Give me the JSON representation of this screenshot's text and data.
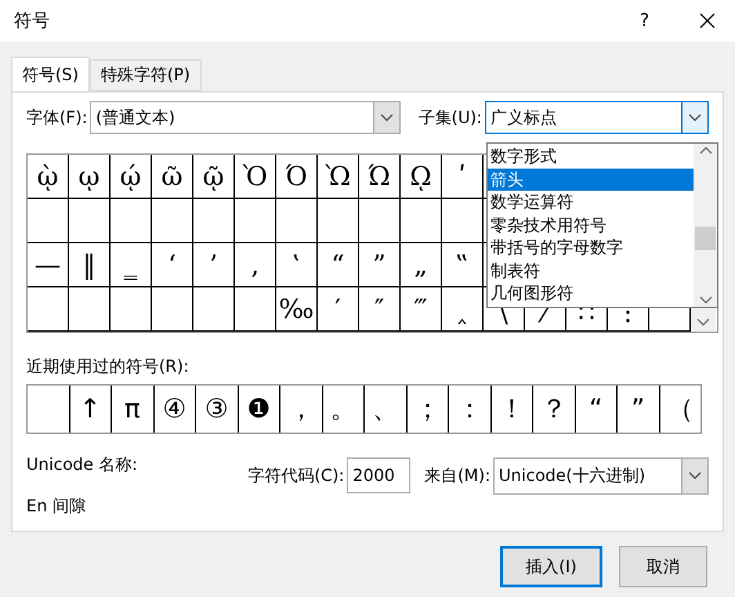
{
  "window": {
    "title": "符号",
    "help": "?"
  },
  "tabs": [
    {
      "label": "符号(S)",
      "selected": true
    },
    {
      "label": "特殊字符(P)",
      "selected": false
    }
  ],
  "font": {
    "label": "字体(F):",
    "value": "(普通文本)"
  },
  "subset": {
    "label": "子集(U):",
    "value": "广义标点",
    "expanded": true
  },
  "symbol_grid": [
    [
      {
        "kind": "symbol",
        "symbol": "ῲ"
      },
      {
        "kind": "symbol",
        "symbol": "ῳ"
      },
      {
        "kind": "symbol",
        "symbol": "ῴ"
      },
      {
        "kind": "symbol",
        "symbol": "ῶ"
      },
      {
        "kind": "symbol",
        "symbol": "ῷ"
      },
      {
        "kind": "symbol",
        "symbol": "Ὸ"
      },
      {
        "kind": "symbol",
        "symbol": "Ό"
      },
      {
        "kind": "symbol",
        "symbol": "Ὼ"
      },
      {
        "kind": "symbol",
        "symbol": "Ώ"
      },
      {
        "kind": "symbol",
        "symbol": "ῼ"
      },
      {
        "kind": "symbol",
        "symbol": "ʹ"
      }
    ],
    [
      {
        "kind": "empty"
      },
      {
        "kind": "empty"
      },
      {
        "kind": "empty"
      },
      {
        "kind": "empty"
      },
      {
        "kind": "empty"
      },
      {
        "kind": "empty"
      },
      {
        "kind": "empty"
      },
      {
        "kind": "empty"
      },
      {
        "kind": "empty"
      },
      {
        "kind": "empty"
      },
      {
        "kind": "empty"
      }
    ],
    [
      {
        "kind": "symbol",
        "symbol": "—"
      },
      {
        "kind": "symbol",
        "symbol": "‖"
      },
      {
        "kind": "symbol",
        "symbol": "‗"
      },
      {
        "kind": "symbol",
        "symbol": "‘"
      },
      {
        "kind": "symbol",
        "symbol": "’"
      },
      {
        "kind": "symbol",
        "symbol": "‚"
      },
      {
        "kind": "symbol",
        "symbol": "‛"
      },
      {
        "kind": "symbol",
        "symbol": "“"
      },
      {
        "kind": "symbol",
        "symbol": "”"
      },
      {
        "kind": "symbol",
        "symbol": "„"
      },
      {
        "kind": "symbol",
        "symbol": "‟"
      }
    ],
    [
      {
        "kind": "empty"
      },
      {
        "kind": "empty"
      },
      {
        "kind": "empty"
      },
      {
        "kind": "empty"
      },
      {
        "kind": "empty"
      },
      {
        "kind": "empty"
      },
      {
        "kind": "symbol",
        "symbol": "‰"
      },
      {
        "kind": "symbol",
        "symbol": "′"
      },
      {
        "kind": "symbol",
        "symbol": "″"
      },
      {
        "kind": "symbol",
        "symbol": "‴"
      },
      {
        "kind": "symbol",
        "symbol": "‸"
      },
      {
        "kind": "symbol",
        "symbol": "\\"
      },
      {
        "kind": "symbol",
        "symbol": "⁄"
      },
      {
        "kind": "symbol",
        "symbol": "∷"
      },
      {
        "kind": "symbol",
        "symbol": ":"
      },
      {
        "kind": "empty"
      }
    ]
  ],
  "subset_list": [
    {
      "label": "数字形式",
      "selected": false
    },
    {
      "label": "箭头",
      "selected": true
    },
    {
      "label": "数学运算符",
      "selected": false
    },
    {
      "label": "零杂技术用符号",
      "selected": false
    },
    {
      "label": "带括号的字母数字",
      "selected": false
    },
    {
      "label": "制表符",
      "selected": false
    },
    {
      "label": "几何图形符",
      "selected": false
    }
  ],
  "recent": {
    "label": "近期使用过的符号(R):",
    "symbols": [
      {
        "kind": "empty"
      },
      {
        "kind": "symbol",
        "symbol": "↑"
      },
      {
        "kind": "symbol",
        "symbol": "π"
      },
      {
        "kind": "symbol",
        "symbol": "④"
      },
      {
        "kind": "symbol",
        "symbol": "③"
      },
      {
        "kind": "symbol",
        "symbol": "❶"
      },
      {
        "kind": "symbol",
        "symbol": "，"
      },
      {
        "kind": "symbol",
        "symbol": "。"
      },
      {
        "kind": "symbol",
        "symbol": "、"
      },
      {
        "kind": "symbol",
        "symbol": "；"
      },
      {
        "kind": "symbol",
        "symbol": "："
      },
      {
        "kind": "symbol",
        "symbol": "！"
      },
      {
        "kind": "symbol",
        "symbol": "？"
      },
      {
        "kind": "symbol",
        "symbol": "“"
      },
      {
        "kind": "symbol",
        "symbol": "”"
      },
      {
        "kind": "symbol",
        "symbol": "（"
      }
    ]
  },
  "unicode_name": {
    "label": "Unicode 名称:",
    "value": "En 间隙"
  },
  "char_code": {
    "label": "字符代码(C):",
    "value": "2000"
  },
  "from": {
    "label": "来自(M):",
    "value": "Unicode(十六进制)"
  },
  "buttons": [
    {
      "label": "插入(I)",
      "default": true
    },
    {
      "label": "取消",
      "default": false
    }
  ]
}
